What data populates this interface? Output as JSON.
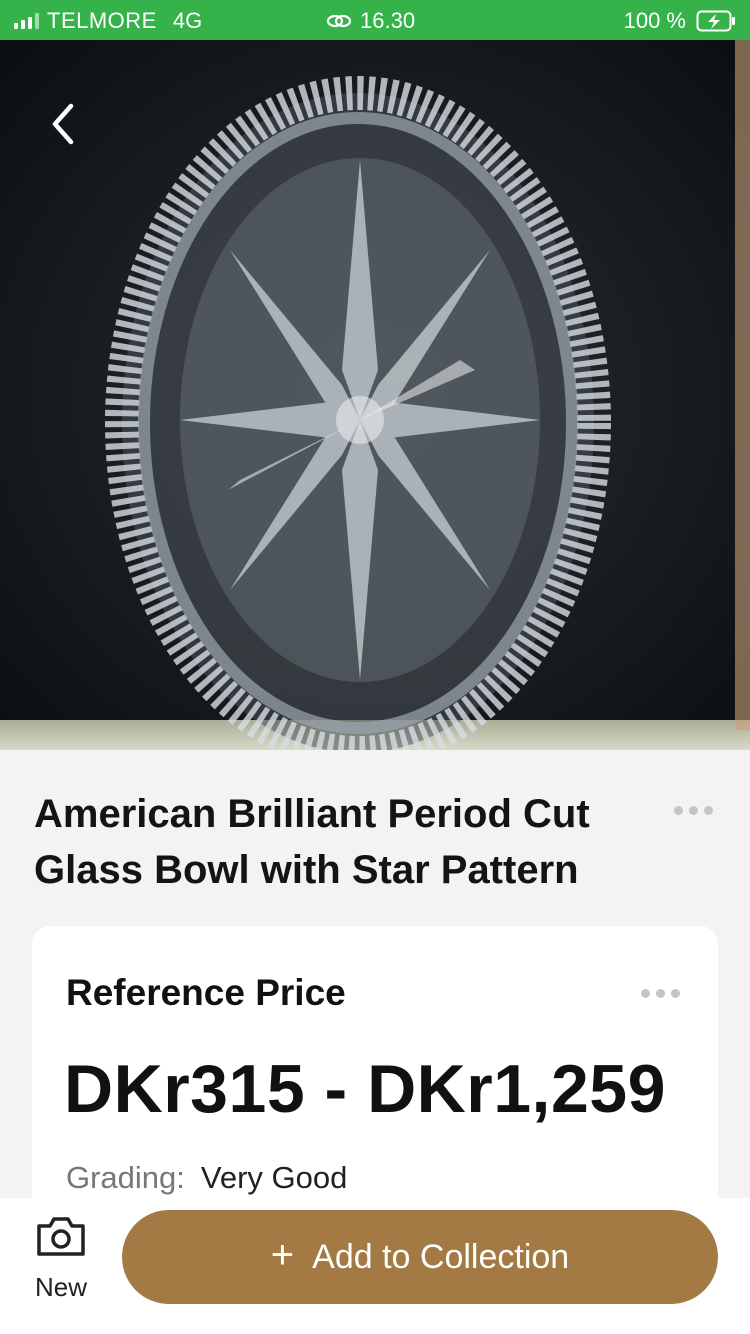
{
  "status_bar": {
    "carrier": "TELMORE",
    "network": "4G",
    "time": "16.30",
    "battery": "100 %"
  },
  "header": {
    "back_icon": "chevron-left-icon"
  },
  "item": {
    "title": "American Brilliant Period Cut Glass Bowl with Star Pattern"
  },
  "reference_card": {
    "title": "Reference Price",
    "price_range": "DKr315 - DKr1,259",
    "grading_label": "Grading:",
    "grading_value": "Very Good"
  },
  "bottom_bar": {
    "new_label": "New",
    "add_label": "Add to Collection",
    "add_icon": "+"
  },
  "colors": {
    "status_bar": "#35b34a",
    "accent": "#a37a44"
  }
}
